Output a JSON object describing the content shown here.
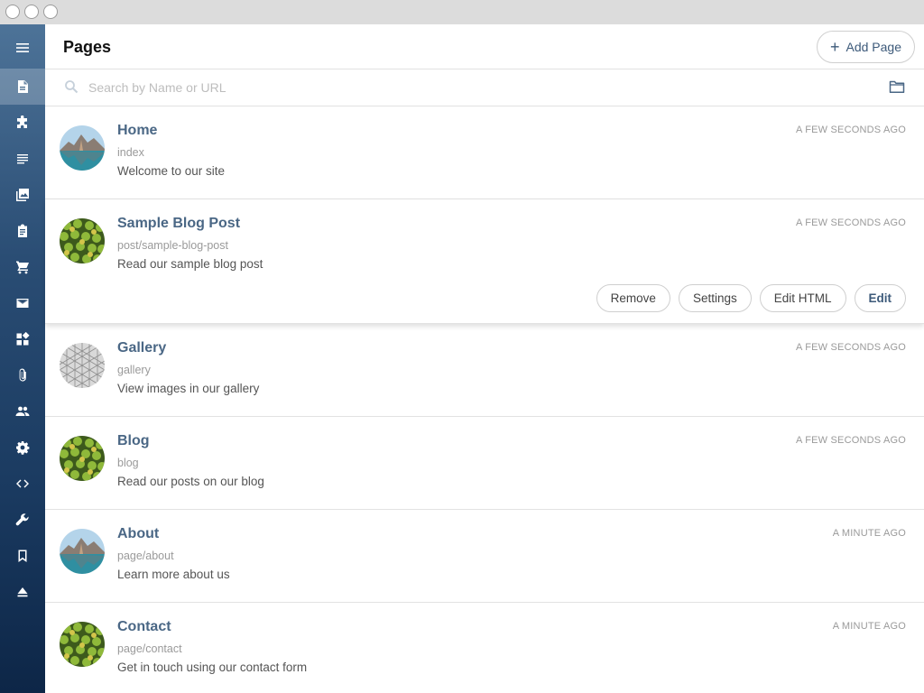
{
  "header": {
    "title": "Pages",
    "add_label": "Add Page"
  },
  "search": {
    "placeholder": "Search by Name or URL"
  },
  "sidebar": {
    "icons": [
      "menu-icon",
      "pages-icon",
      "plugins-icon",
      "list-icon",
      "gallery-icon",
      "clipboard-icon",
      "cart-icon",
      "mail-icon",
      "dashboard-icon",
      "attachment-icon",
      "users-icon",
      "gear-icon",
      "code-icon",
      "wrench-icon",
      "bookmark-icon",
      "eject-icon"
    ]
  },
  "pages": [
    {
      "title": "Home",
      "url": "index",
      "description": "Welcome to our site",
      "time": "A FEW SECONDS AGO",
      "thumb": "mountain-lake"
    },
    {
      "title": "Sample Blog Post",
      "url": "post/sample-blog-post",
      "description": "Read our sample blog post",
      "time": "A FEW SECONDS AGO",
      "thumb": "green-fruit"
    },
    {
      "title": "Gallery",
      "url": "gallery",
      "description": "View images in our gallery",
      "time": "A FEW SECONDS AGO",
      "thumb": "geodesic-dome"
    },
    {
      "title": "Blog",
      "url": "blog",
      "description": "Read our posts on our blog",
      "time": "A FEW SECONDS AGO",
      "thumb": "green-fruit"
    },
    {
      "title": "About",
      "url": "page/about",
      "description": "Learn more about us",
      "time": "A MINUTE AGO",
      "thumb": "mountain-lake"
    },
    {
      "title": "Contact",
      "url": "page/contact",
      "description": "Get in touch using our contact form",
      "time": "A MINUTE AGO",
      "thumb": "green-fruit"
    }
  ],
  "actions": {
    "remove": "Remove",
    "settings": "Settings",
    "edit_html": "Edit HTML",
    "edit": "Edit"
  },
  "colors": {
    "accent": "#4a6785",
    "sidebar_top": "#4d7398",
    "sidebar_bottom": "#0d2647"
  }
}
